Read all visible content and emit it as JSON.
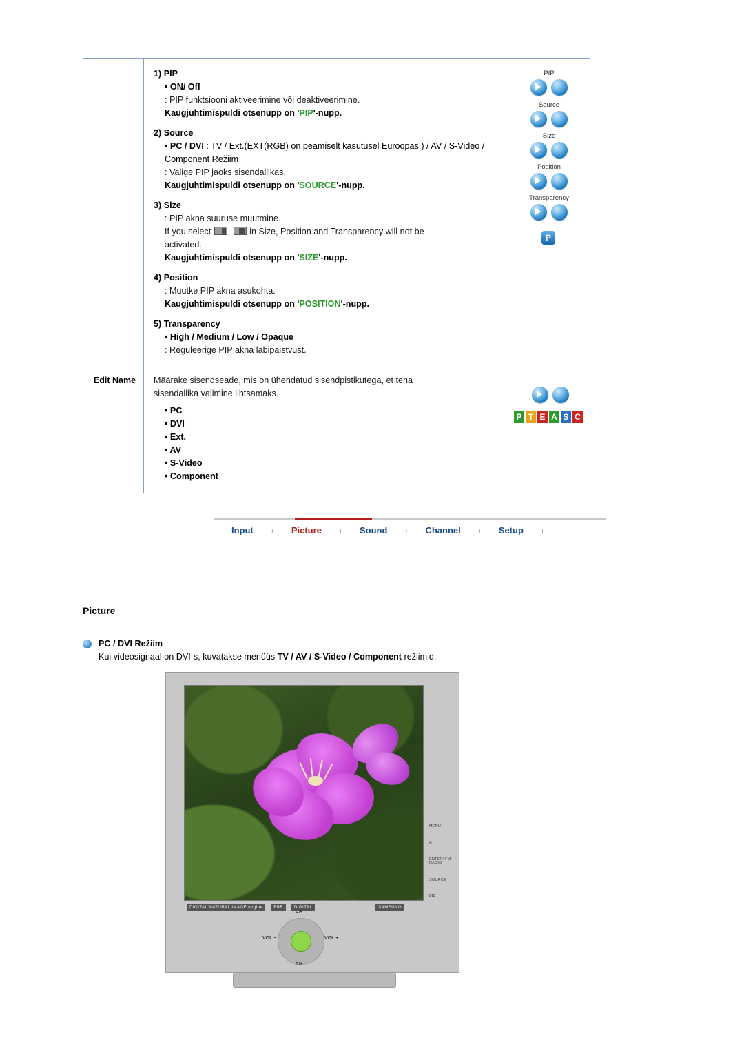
{
  "table": {
    "pip_section": {
      "items": [
        {
          "num": "1) PIP",
          "bullets": [
            "ON/ Off"
          ],
          "lines": [
            ": PIP funktsiooni aktiveerimine või deaktiveerimine."
          ],
          "remote_prefix": "Kaugjuhtimispuldi otsenupp on '",
          "remote_key": "PIP",
          "remote_suffix": "'-nupp."
        },
        {
          "num": "2) Source",
          "bullets": [
            "PC / DVI"
          ],
          "bullet_tail": " : TV / Ext.(EXT(RGB) on peamiselt kasutusel Euroopas.) / AV / S-Video / Component Režiim",
          "lines": [
            ": Valige PIP jaoks sisendallikas."
          ],
          "remote_prefix": "Kaugjuhtimispuldi otsenupp on '",
          "remote_key": "SOURCE",
          "remote_suffix": "'-nupp."
        },
        {
          "num": "3) Size",
          "bullets": [],
          "lines": [
            ": PIP akna suuruse muutmine."
          ],
          "special_line_pre": "If you select ",
          "special_line_post": " in Size, Position and Transparency will not be",
          "special_line_2": "activated.",
          "remote_prefix": "Kaugjuhtimispuldi otsenupp on '",
          "remote_key": "SIZE",
          "remote_suffix": "'-nupp."
        },
        {
          "num": "4) Position",
          "bullets": [],
          "lines": [
            ": Muutke PIP akna asukohta."
          ],
          "remote_prefix": "Kaugjuhtimispuldi otsenupp on '",
          "remote_key": "POSITION",
          "remote_suffix": "'-nupp."
        },
        {
          "num": "5) Transparency",
          "bullets": [
            "High / Medium / Low / Opaque"
          ],
          "lines": [
            ": Reguleerige PIP akna läbipaistvust."
          ]
        }
      ],
      "figure_captions": [
        "PIP",
        "Source",
        "Size",
        "Position",
        "Transparency"
      ],
      "figure_button": "P"
    },
    "edit_name": {
      "label": "Edit Name",
      "lines": [
        "Määrake sisendseade, mis on ühendatud sisendpistikutega, et teha",
        "sisendallika valimine lihtsamaks."
      ],
      "bullets": [
        "PC",
        "DVI",
        "Ext.",
        "AV",
        "S-Video",
        "Component"
      ],
      "figure_letters": [
        {
          "ch": "P",
          "color": "#2f9b2f"
        },
        {
          "ch": "T",
          "color": "#e8a317"
        },
        {
          "ch": "E",
          "color": "#cf2222"
        },
        {
          "ch": "A",
          "color": "#2f9b2f"
        },
        {
          "ch": "S",
          "color": "#2a6fc4"
        },
        {
          "ch": "C",
          "color": "#cf2222"
        }
      ]
    }
  },
  "nav": {
    "items": [
      {
        "label": "Input",
        "active": false
      },
      {
        "label": "Picture",
        "active": true
      },
      {
        "label": "Sound",
        "active": false
      },
      {
        "label": "Channel",
        "active": false
      },
      {
        "label": "Setup",
        "active": false
      }
    ],
    "separator": "ı",
    "active_color": "#b42020",
    "link_color": "#1a4f8a"
  },
  "section": {
    "title": "Picture",
    "subtitle": "PC / DVI Režiim",
    "body_pre": "Kui videosignaal on DVI-s, kuvatakse menüüs ",
    "body_bold": "TV / AV / S-Video / Component",
    "body_post": " režiimid."
  },
  "monitor": {
    "side_buttons": [
      "MENU",
      "A'",
      "ENTER/\nFM RADIO",
      "SOURCE",
      "PIP"
    ],
    "brand_marks": [
      "DIGITAL NATURAL IMAGE engine",
      "BBE",
      "DIGITAL",
      "SAMSUNG"
    ],
    "controls": {
      "up": "CH",
      "down": "CH",
      "left": "VOL −",
      "right": "VOL +"
    }
  }
}
